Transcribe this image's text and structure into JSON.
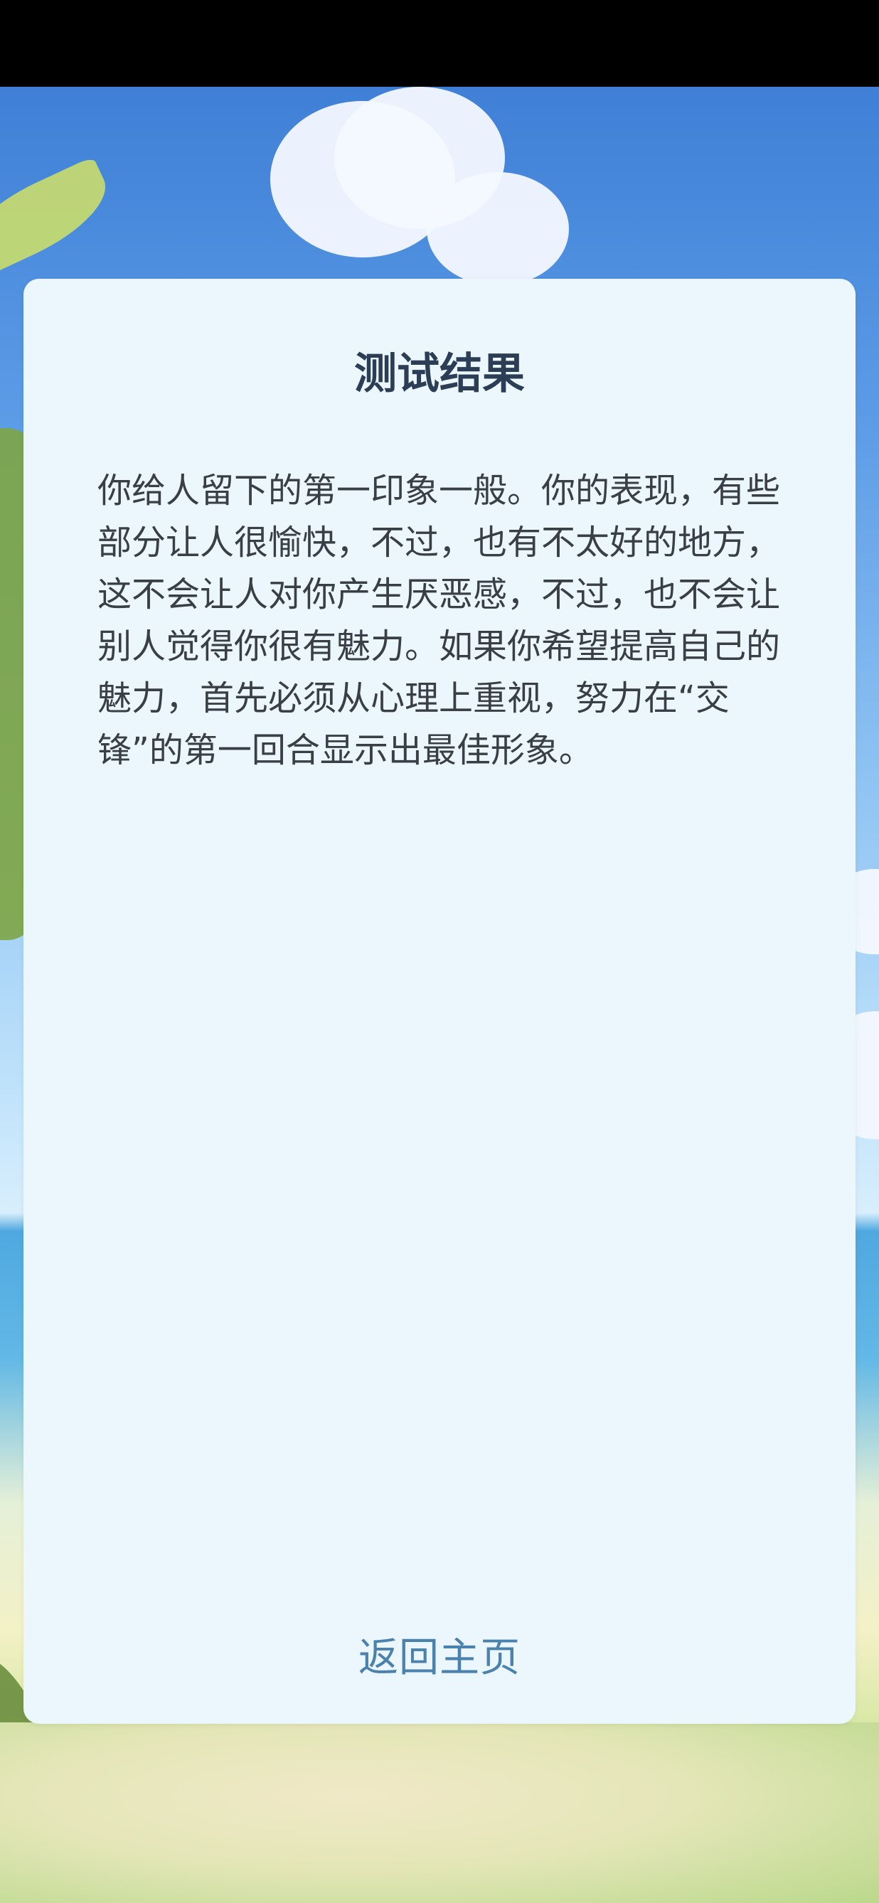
{
  "result": {
    "title": "测试结果",
    "body": "你给人留下的第一印象一般。你的表现，有些部分让人很愉快，不过，也有不太好的地方，这不会让人对你产生厌恶感，不过，也不会让别人觉得你很有魅力。如果你希望提高自己的魅力，首先必须从心理上重视，努力在“交锋”的第一回合显示出最佳形象。",
    "back_label": "返回主页"
  },
  "colors": {
    "card_background": "#ebf6fd",
    "title": "#2c3e55",
    "body_text": "#3a3f46",
    "link": "#4a82ad"
  }
}
